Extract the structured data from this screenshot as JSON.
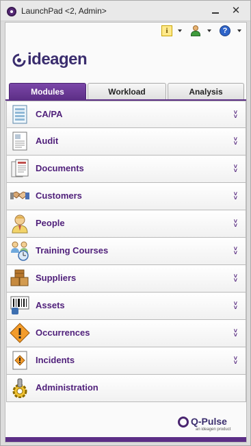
{
  "window": {
    "title": "LaunchPad <2, Admin>"
  },
  "toolbar": {
    "info_symbol": "i",
    "help_symbol": "?"
  },
  "logo": {
    "text": "ideagen"
  },
  "tabs": [
    {
      "label": "Modules",
      "active": true
    },
    {
      "label": "Workload",
      "active": false
    },
    {
      "label": "Analysis",
      "active": false
    }
  ],
  "modules": [
    {
      "label": "CA/PA",
      "icon": "document-list-icon",
      "expandable": true
    },
    {
      "label": "Audit",
      "icon": "audit-document-icon",
      "expandable": true
    },
    {
      "label": "Documents",
      "icon": "documents-icon",
      "expandable": true
    },
    {
      "label": "Customers",
      "icon": "handshake-icon",
      "expandable": true
    },
    {
      "label": "People",
      "icon": "person-icon",
      "expandable": true
    },
    {
      "label": "Training Courses",
      "icon": "training-clock-icon",
      "expandable": true
    },
    {
      "label": "Suppliers",
      "icon": "boxes-icon",
      "expandable": true
    },
    {
      "label": "Assets",
      "icon": "barcode-icon",
      "expandable": true
    },
    {
      "label": "Occurrences",
      "icon": "warning-diamond-icon",
      "expandable": true
    },
    {
      "label": "Incidents",
      "icon": "incident-report-icon",
      "expandable": true
    },
    {
      "label": "Administration",
      "icon": "gear-icon",
      "expandable": false
    }
  ],
  "footer": {
    "brand": "Q-Pulse",
    "tagline": "an ideagen product"
  },
  "colors": {
    "accent": "#5c2e86",
    "label": "#4f1f7a",
    "brand_text": "#3a2d6e"
  }
}
